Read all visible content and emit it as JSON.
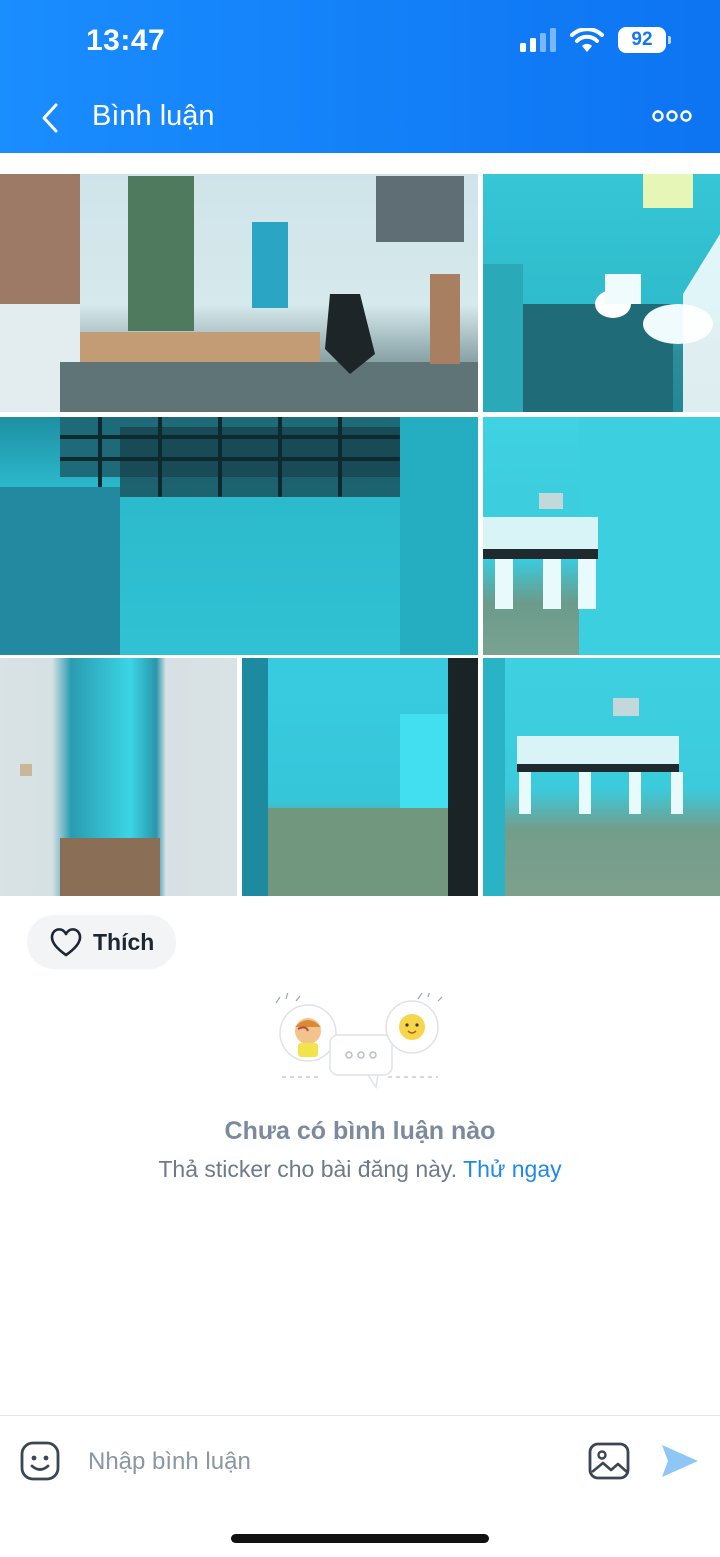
{
  "status_bar": {
    "time": "13:47",
    "battery": "92"
  },
  "header": {
    "title": "Bình luận"
  },
  "photos": [
    {
      "description_name": "photo-1"
    },
    {
      "description_name": "photo-2"
    },
    {
      "description_name": "photo-3"
    },
    {
      "description_name": "photo-4"
    },
    {
      "description_name": "photo-5"
    },
    {
      "description_name": "photo-6"
    },
    {
      "description_name": "photo-7"
    }
  ],
  "like": {
    "label": "Thích"
  },
  "empty_state": {
    "title": "Chưa có bình luận nào",
    "subtitle": "Thả sticker cho bài đăng này.",
    "action": "Thử ngay"
  },
  "composer": {
    "placeholder": "Nhập bình luận"
  },
  "colors": {
    "header_blue": "#0d74f2",
    "link_blue": "#1f88ee",
    "send_blue": "#8ec6f5"
  }
}
